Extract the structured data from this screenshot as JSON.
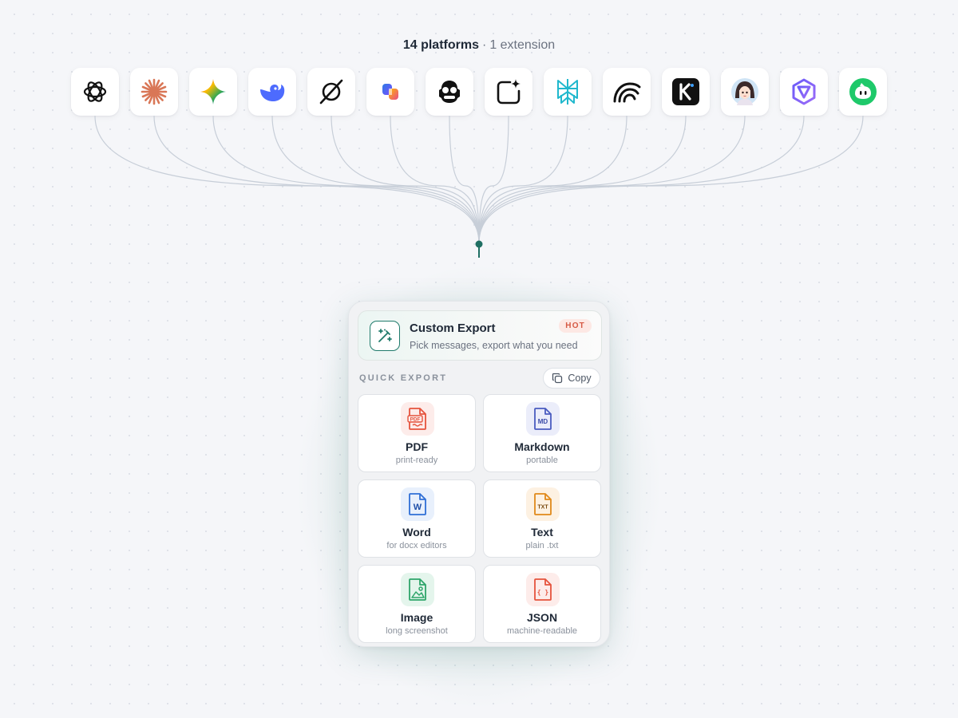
{
  "headline": {
    "platforms": "14 platforms",
    "separator": "·",
    "extension": "1 extension"
  },
  "platforms": [
    {
      "name": "openai-icon"
    },
    {
      "name": "claude-icon",
      "color": "#d97757"
    },
    {
      "name": "gemini-icon"
    },
    {
      "name": "deepseek-icon",
      "color": "#4d6bfe"
    },
    {
      "name": "grok-icon",
      "color": "#111111"
    },
    {
      "name": "copilot-icon"
    },
    {
      "name": "robot-icon",
      "color": "#111111"
    },
    {
      "name": "sparkle-square-icon",
      "color": "#111111"
    },
    {
      "name": "perplexity-icon",
      "color": "#20b8cd"
    },
    {
      "name": "arcs-icon",
      "color": "#111111"
    },
    {
      "name": "kimi-icon",
      "color": "#111111"
    },
    {
      "name": "avatar-icon"
    },
    {
      "name": "qwen-icon",
      "color": "#7b68ee"
    },
    {
      "name": "green-bot-icon",
      "color": "#1ec96a"
    }
  ],
  "panel": {
    "custom_export": {
      "title": "Custom Export",
      "subtitle": "Pick messages, export what you need",
      "badge": "HOT",
      "icon": "magic-wand-icon",
      "accent": "#1f7a6b"
    },
    "quick_export_label": "QUICK EXPORT",
    "copy_label": "Copy",
    "formats": [
      {
        "id": "pdf",
        "name": "PDF",
        "desc": "print-ready",
        "icon": "pdf-icon",
        "color": "#e5533d",
        "tint": "#fdecea",
        "tag": "PDF"
      },
      {
        "id": "markdown",
        "name": "Markdown",
        "desc": "portable",
        "icon": "markdown-icon",
        "color": "#4a5cc0",
        "tint": "#ebedfa",
        "tag": "MD"
      },
      {
        "id": "word",
        "name": "Word",
        "desc": "for docx editors",
        "icon": "word-icon",
        "color": "#2f6fd6",
        "tint": "#e8f0fc",
        "tag": "W"
      },
      {
        "id": "text",
        "name": "Text",
        "desc": "plain .txt",
        "icon": "txt-icon",
        "color": "#e0891a",
        "tint": "#fdf1e2",
        "tag": "TXT"
      },
      {
        "id": "image",
        "name": "Image",
        "desc": "long screenshot",
        "icon": "image-icon",
        "color": "#2ea56a",
        "tint": "#e4f5ec",
        "tag": ""
      },
      {
        "id": "json",
        "name": "JSON",
        "desc": "machine-readable",
        "icon": "json-icon",
        "color": "#e5533d",
        "tint": "#fdecea",
        "tag": "{ }"
      }
    ]
  }
}
